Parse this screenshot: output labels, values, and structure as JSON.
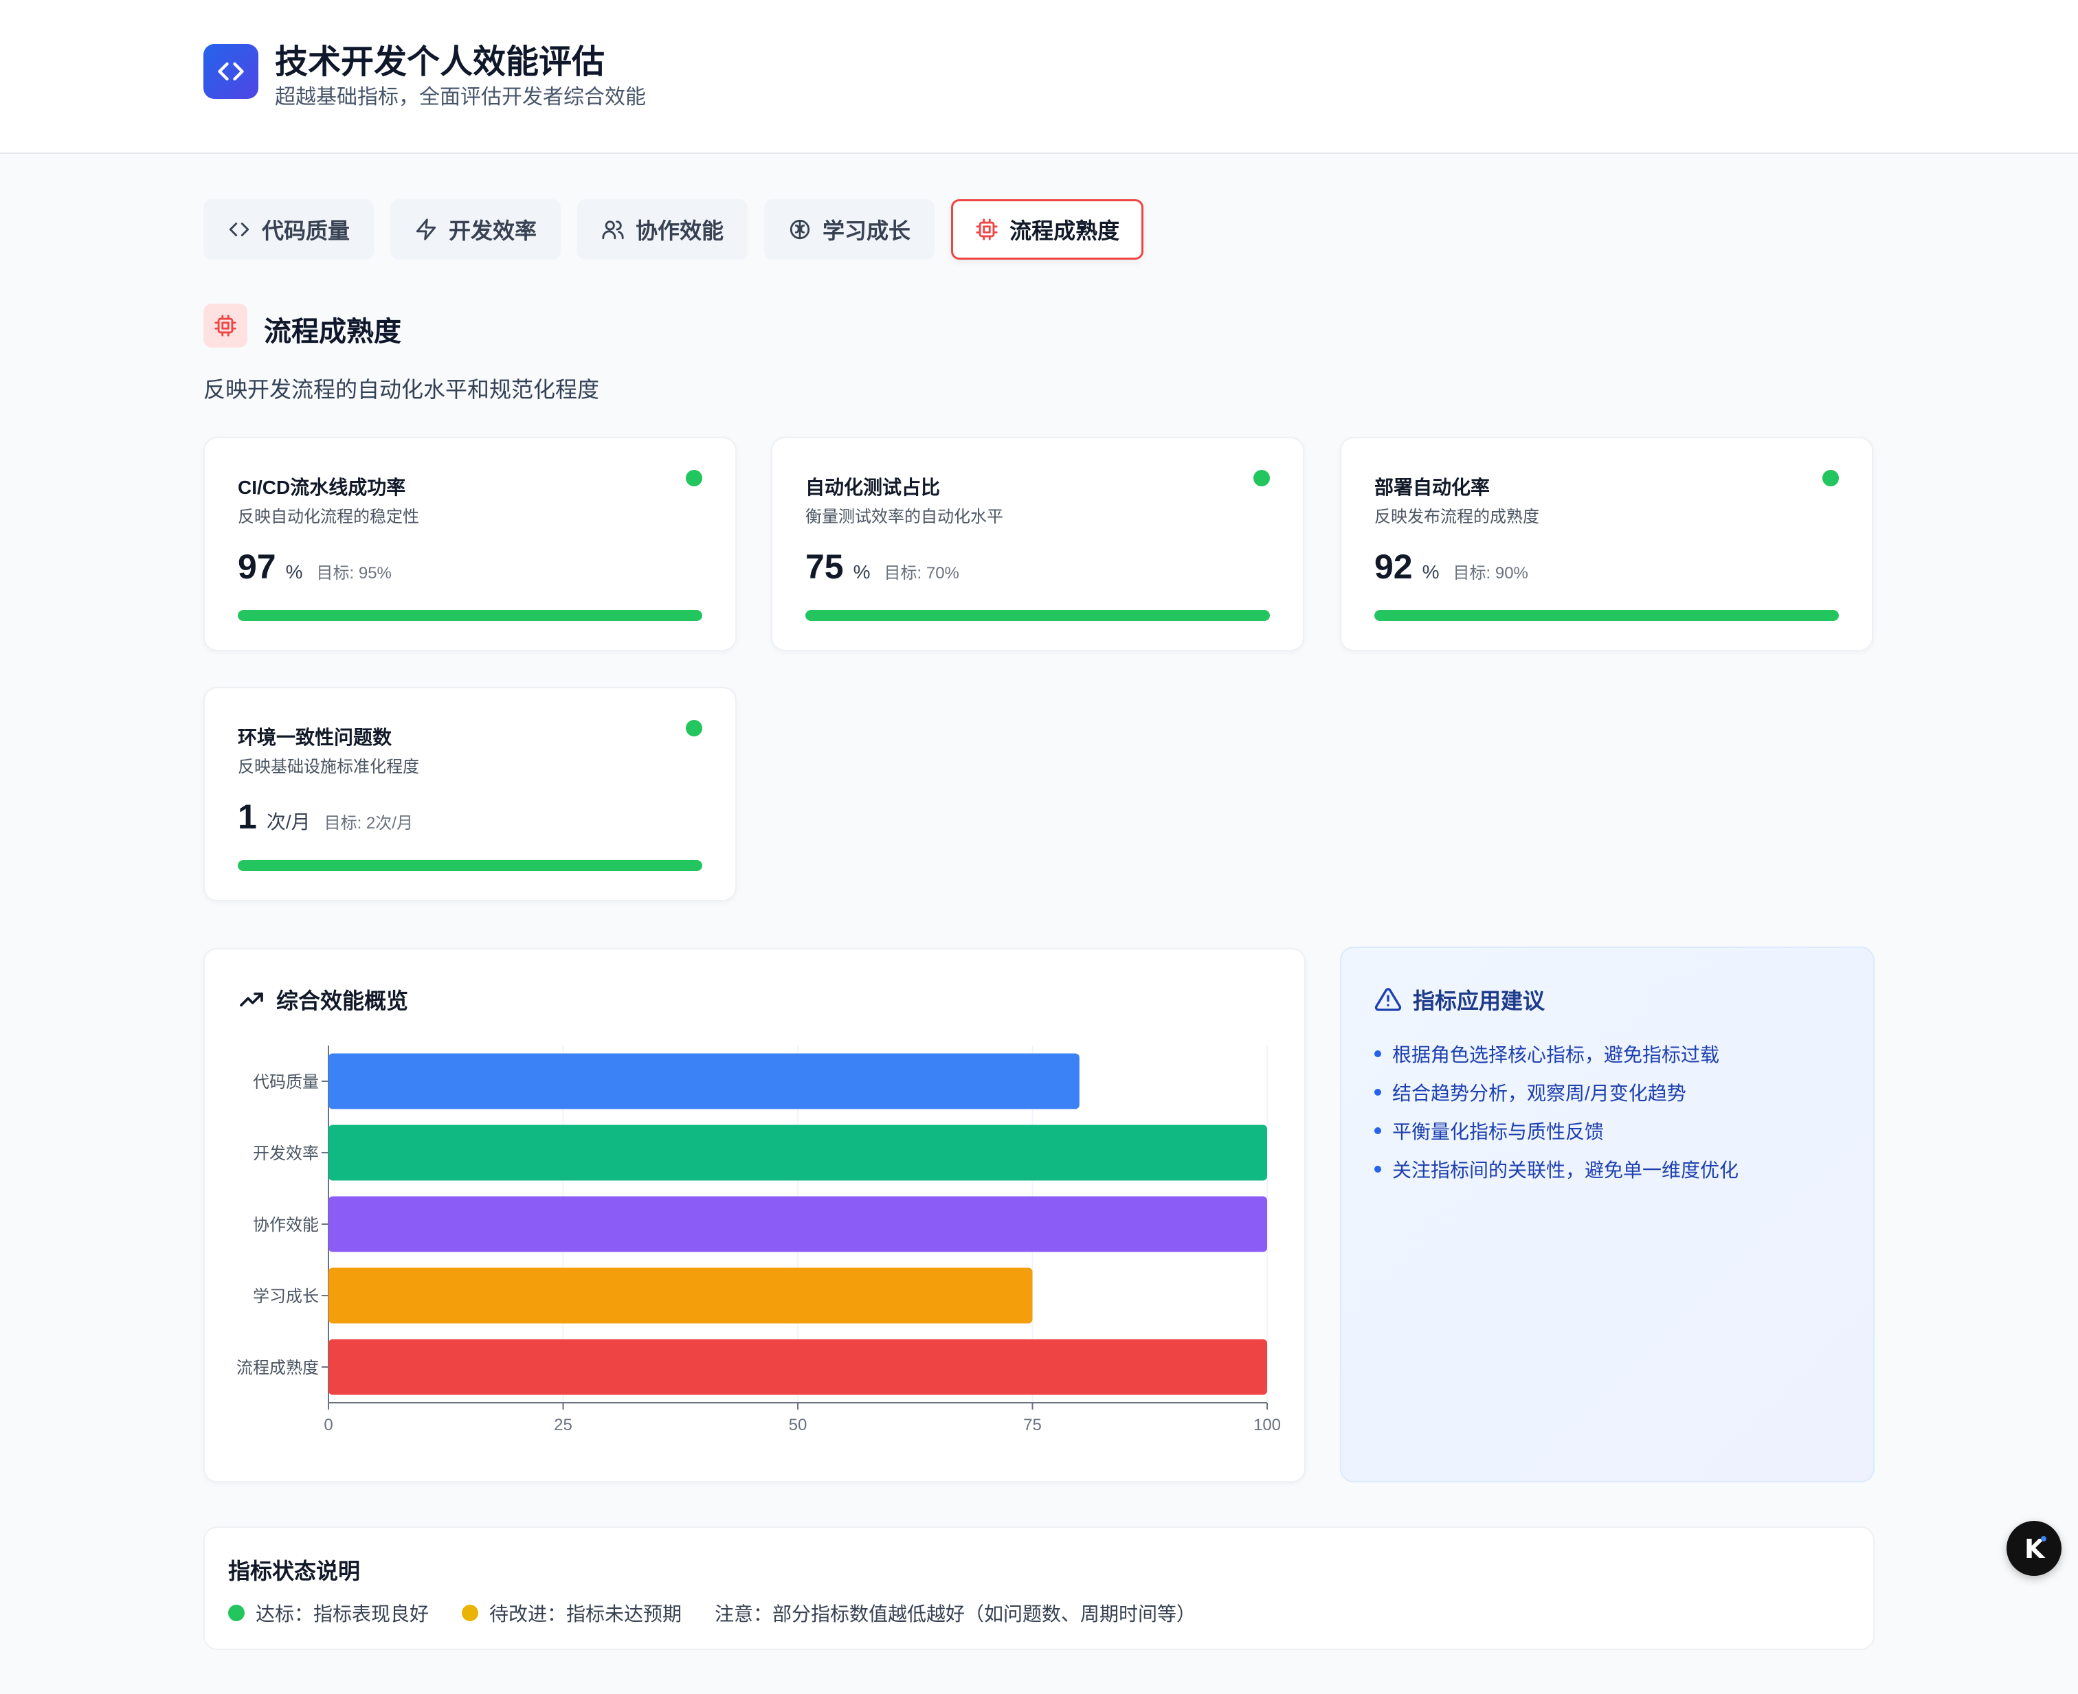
{
  "header": {
    "title": "技术开发个人效能评估",
    "subtitle": "超越基础指标，全面评估开发者综合效能",
    "logo_icon": "code-brackets-icon"
  },
  "tabs": [
    {
      "label": "代码质量",
      "icon": "code-icon",
      "active": false
    },
    {
      "label": "开发效率",
      "icon": "lightning-icon",
      "active": false
    },
    {
      "label": "协作效能",
      "icon": "users-icon",
      "active": false
    },
    {
      "label": "学习成长",
      "icon": "brain-icon",
      "active": false
    },
    {
      "label": "流程成熟度",
      "icon": "cpu-icon",
      "active": true
    }
  ],
  "section": {
    "title": "流程成熟度",
    "description": "反映开发流程的自动化水平和规范化程度",
    "icon": "cpu-icon",
    "accent": "#ef4444"
  },
  "metrics": [
    {
      "name": "CI/CD流水线成功率",
      "desc": "反映自动化流程的稳定性",
      "value": "97",
      "unit": "%",
      "target": "目标: 95%",
      "status": "good",
      "progress": 1.0
    },
    {
      "name": "自动化测试占比",
      "desc": "衡量测试效率的自动化水平",
      "value": "75",
      "unit": "%",
      "target": "目标: 70%",
      "status": "good",
      "progress": 1.0
    },
    {
      "name": "部署自动化率",
      "desc": "反映发布流程的成熟度",
      "value": "92",
      "unit": "%",
      "target": "目标: 90%",
      "status": "good",
      "progress": 1.0
    },
    {
      "name": "环境一致性问题数",
      "desc": "反映基础设施标准化程度",
      "value": "1",
      "unit": "次/月",
      "target": "目标: 2次/月",
      "status": "good",
      "progress": 1.0
    }
  ],
  "overview": {
    "title": "综合效能概览",
    "icon": "trending-up-icon"
  },
  "chart_data": {
    "type": "bar",
    "orientation": "horizontal",
    "categories": [
      "代码质量",
      "开发效率",
      "协作效能",
      "学习成长",
      "流程成熟度"
    ],
    "values": [
      80,
      100,
      100,
      75,
      100
    ],
    "colors": [
      "#3b82f6",
      "#10b981",
      "#8b5cf6",
      "#f59e0b",
      "#ef4444"
    ],
    "xlim": [
      0,
      100
    ],
    "xticks": [
      "0",
      "25",
      "50",
      "75",
      "100"
    ],
    "grid": "vertical"
  },
  "advice": {
    "title": "指标应用建议",
    "icon": "warning-triangle-icon",
    "items": [
      "根据角色选择核心指标，避免指标过载",
      "结合趋势分析，观察周/月变化趋势",
      "平衡量化指标与质性反馈",
      "关注指标间的关联性，避免单一维度优化"
    ]
  },
  "legend": {
    "title": "指标状态说明",
    "good": "达标：指标表现良好",
    "improve": "待改进：指标未达预期",
    "note": "注意：部分指标数值越低越好（如问题数、周期时间等）",
    "good_color": "#22c55e",
    "improve_color": "#eab308"
  },
  "fab": {
    "label": "K",
    "icon": "assistant-k-icon"
  }
}
